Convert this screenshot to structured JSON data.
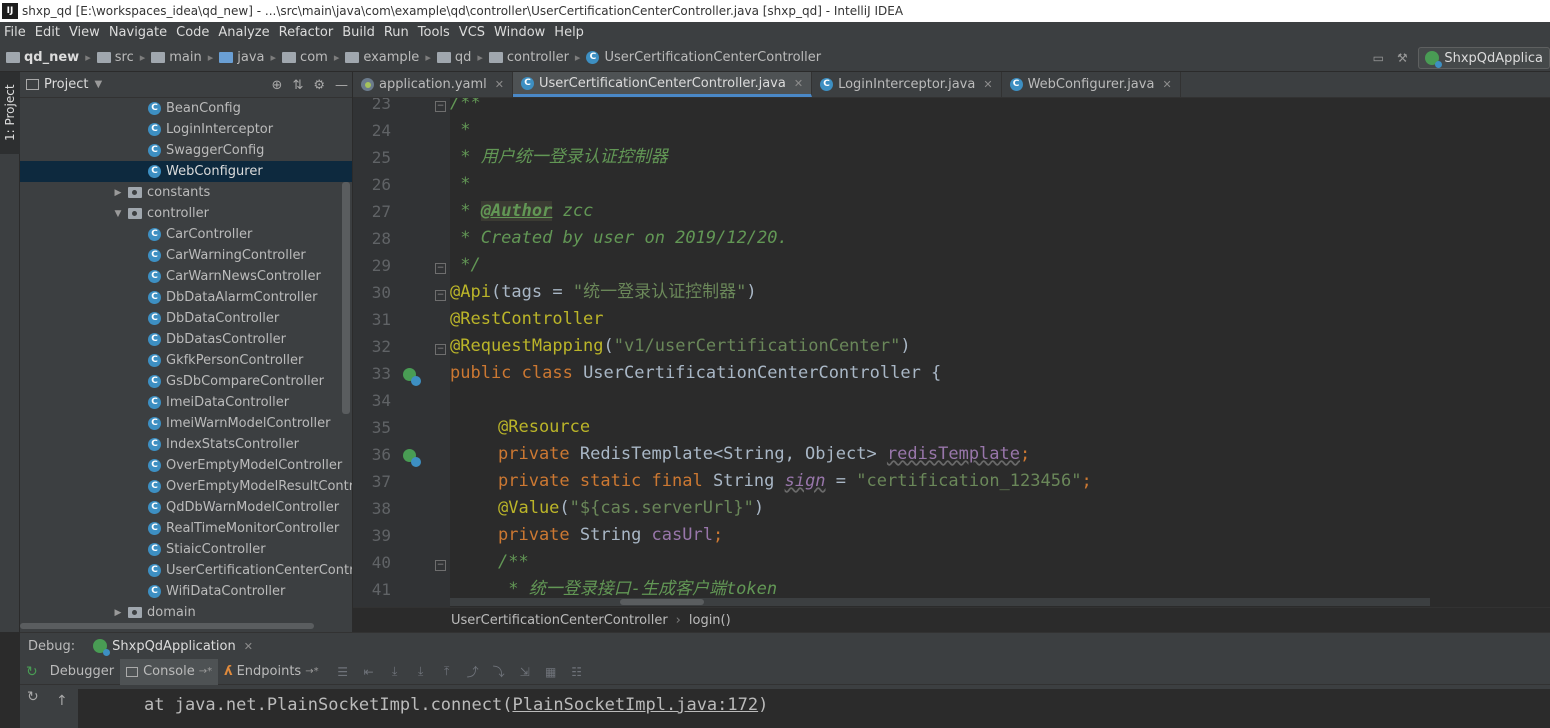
{
  "title_bar": {
    "icon_text": "IJ",
    "title": "shxp_qd [E:\\workspaces_idea\\qd_new] - ...\\src\\main\\java\\com\\example\\qd\\controller\\UserCertificationCenterController.java [shxp_qd] - IntelliJ IDEA"
  },
  "menu": [
    "File",
    "Edit",
    "View",
    "Navigate",
    "Code",
    "Analyze",
    "Refactor",
    "Build",
    "Run",
    "Tools",
    "VCS",
    "Window",
    "Help"
  ],
  "nav": {
    "crumbs": [
      "qd_new",
      "src",
      "main",
      "java",
      "com",
      "example",
      "qd",
      "controller",
      "UserCertificationCenterController"
    ],
    "run_config": "ShxpQdApplica"
  },
  "left_strip": {
    "project_tab": "1: Project"
  },
  "project_panel": {
    "title": "Project",
    "items": [
      {
        "label": "BeanConfig",
        "kind": "class",
        "indent": 3
      },
      {
        "label": "LoginInterceptor",
        "kind": "class",
        "indent": 3
      },
      {
        "label": "SwaggerConfig",
        "kind": "class",
        "indent": 3
      },
      {
        "label": "WebConfigurer",
        "kind": "class",
        "indent": 3,
        "selected": true
      },
      {
        "label": "constants",
        "kind": "package",
        "indent": 2,
        "arrow": "▶"
      },
      {
        "label": "controller",
        "kind": "package",
        "indent": 2,
        "arrow": "▼"
      },
      {
        "label": "CarController",
        "kind": "class",
        "indent": 3
      },
      {
        "label": "CarWarningController",
        "kind": "class",
        "indent": 3
      },
      {
        "label": "CarWarnNewsController",
        "kind": "class",
        "indent": 3
      },
      {
        "label": "DbDataAlarmController",
        "kind": "class",
        "indent": 3
      },
      {
        "label": "DbDataController",
        "kind": "class",
        "indent": 3
      },
      {
        "label": "DbDatasController",
        "kind": "class",
        "indent": 3
      },
      {
        "label": "GkfkPersonController",
        "kind": "class",
        "indent": 3
      },
      {
        "label": "GsDbCompareController",
        "kind": "class",
        "indent": 3
      },
      {
        "label": "ImeiDataController",
        "kind": "class",
        "indent": 3
      },
      {
        "label": "ImeiWarnModelController",
        "kind": "class",
        "indent": 3
      },
      {
        "label": "IndexStatsController",
        "kind": "class",
        "indent": 3
      },
      {
        "label": "OverEmptyModelController",
        "kind": "class",
        "indent": 3
      },
      {
        "label": "OverEmptyModelResultControlle",
        "kind": "class",
        "indent": 3
      },
      {
        "label": "QdDbWarnModelController",
        "kind": "class",
        "indent": 3
      },
      {
        "label": "RealTimeMonitorController",
        "kind": "class",
        "indent": 3
      },
      {
        "label": "StiaicController",
        "kind": "class",
        "indent": 3
      },
      {
        "label": "UserCertificationCenterControlle",
        "kind": "class",
        "indent": 3
      },
      {
        "label": "WifiDataController",
        "kind": "class",
        "indent": 3
      },
      {
        "label": "domain",
        "kind": "package",
        "indent": 2,
        "arrow": "▶"
      }
    ]
  },
  "editor": {
    "tabs": [
      {
        "label": "application.yaml",
        "icon": "yaml-icon",
        "active": false
      },
      {
        "label": "UserCertificationCenterController.java",
        "icon": "class-icon",
        "active": true
      },
      {
        "label": "LoginInterceptor.java",
        "icon": "class-icon",
        "active": false
      },
      {
        "label": "WebConfigurer.java",
        "icon": "class-icon",
        "active": false
      }
    ],
    "line_numbers": [
      "23",
      "24",
      "25",
      "26",
      "27",
      "28",
      "29",
      "30",
      "31",
      "32",
      "33",
      "34",
      "35",
      "36",
      "37",
      "38",
      "39",
      "40",
      "41"
    ],
    "code": {
      "l23": "/**",
      "l24": " *",
      "l25": " * 用户统一登录认证控制器",
      "l26": " *",
      "l27_prefix": " * ",
      "l27_tag": "@Author",
      "l27_rest": " zcc",
      "l28": " * Created by user on 2019/12/20.",
      "l29": " */",
      "l30_ann": "@Api",
      "l30_mid": "(tags = ",
      "l30_str": "\"统一登录认证控制器\"",
      "l30_end": ")",
      "l31": "@RestController",
      "l32_ann": "@RequestMapping",
      "l32_open": "(",
      "l32_str": "\"v1/userCertificationCenter\"",
      "l32_end": ")",
      "l33_kw": "public class ",
      "l33_rest": "UserCertificationCenterController {",
      "l35": "@Resource",
      "l36_kw": "private ",
      "l36_type": "RedisTemplate<String, Object> ",
      "l36_field": "redisTemplate",
      "l36_semi": ";",
      "l37_kw": "private static final ",
      "l37_type": "String ",
      "l37_field": "sign",
      "l37_eq": " = ",
      "l37_str": "\"certification_123456\"",
      "l37_semi": ";",
      "l38_ann": "@Value",
      "l38_open": "(",
      "l38_str": "\"${cas.serverUrl}\"",
      "l38_end": ")",
      "l39_kw": "private ",
      "l39_type": "String ",
      "l39_field": "casUrl",
      "l39_semi": ";",
      "l40": "/**",
      "l41": " * 统一登录接口-生成客户端token"
    },
    "breadcrumb": [
      "UserCertificationCenterController",
      "login()"
    ]
  },
  "debug": {
    "label": "Debug:",
    "session": "ShxpQdApplication",
    "tabs": [
      "Debugger",
      "Console",
      "Endpoints"
    ],
    "console_prefix": "at java.net.PlainSocketImpl.connect(",
    "console_link": "PlainSocketImpl.java:172",
    "console_suffix": ")"
  },
  "colors": {
    "editor_bg": "#2b2b2b",
    "panel_bg": "#3c3f41",
    "selection": "#0d293e",
    "doc_comment": "#629755",
    "annotation": "#bbb529",
    "keyword": "#cc7832",
    "string": "#6a8759",
    "field": "#9876aa"
  }
}
